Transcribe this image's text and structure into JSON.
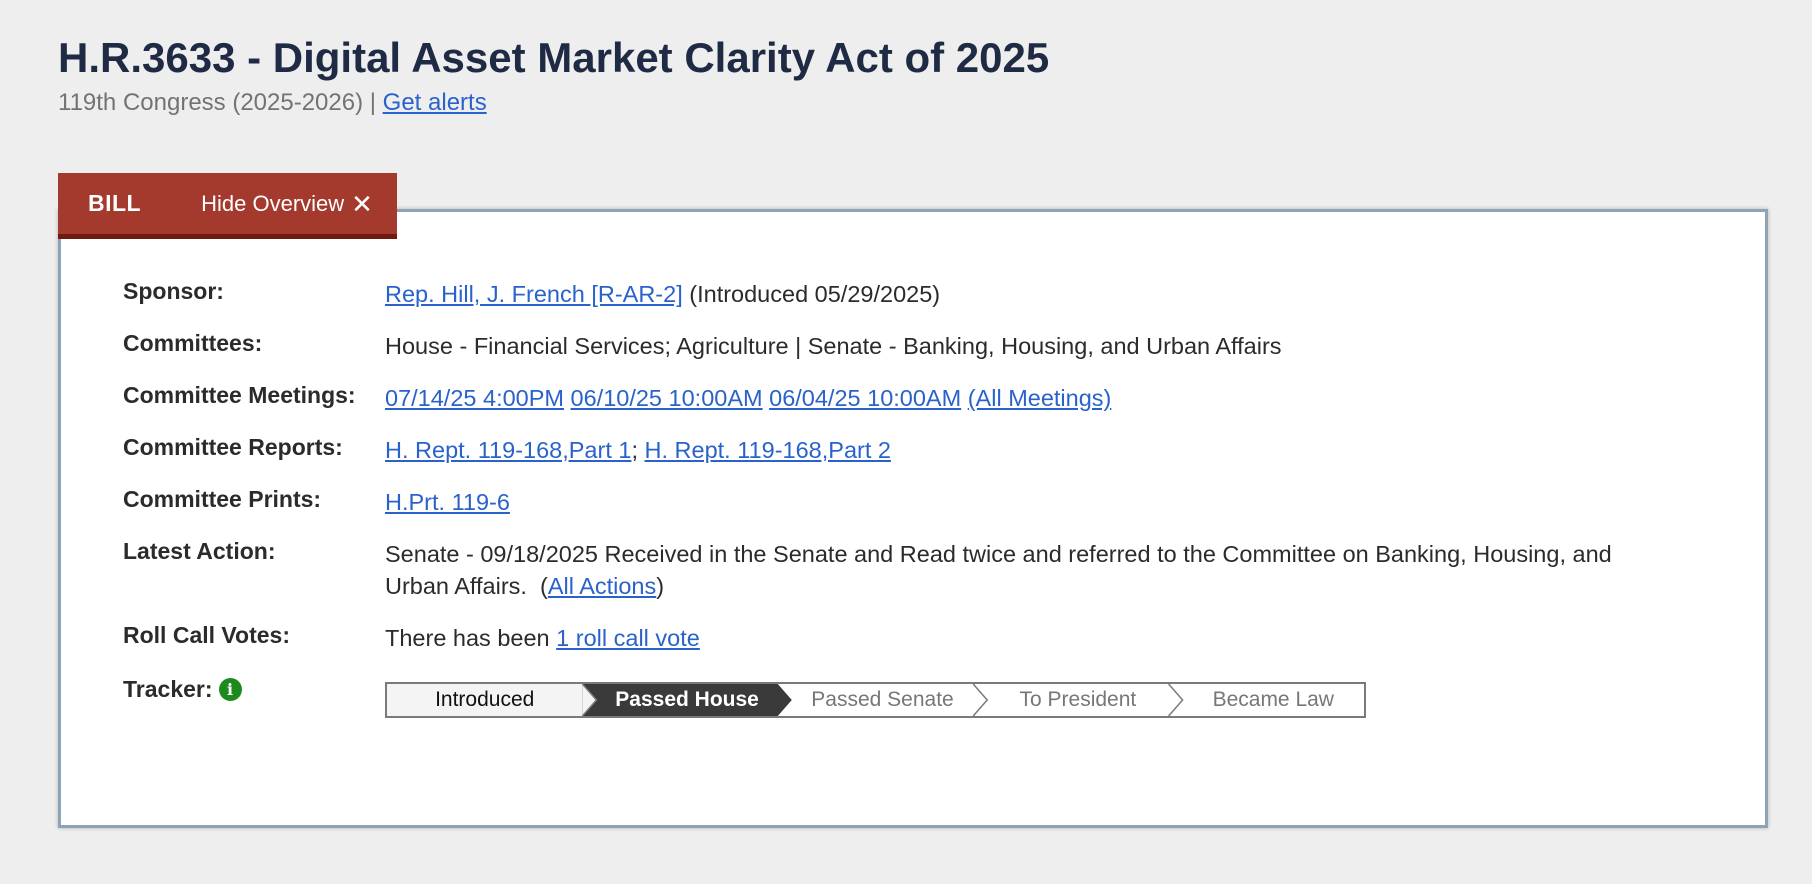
{
  "header": {
    "title": "H.R.3633 - Digital Asset Market Clarity Act of 2025",
    "congress": "119th Congress (2025-2026) | ",
    "alerts_link": "Get alerts"
  },
  "tabs": {
    "bill_label": "BILL",
    "hide_overview_label": "Hide Overview",
    "close_icon": "close-x"
  },
  "overview": {
    "sponsor": {
      "label": "Sponsor:",
      "link": "Rep. Hill, J. French [R-AR-2]",
      "note": " (Introduced 05/29/2025)"
    },
    "committees": {
      "label": "Committees:",
      "text": "House - Financial Services; Agriculture | Senate - Banking, Housing, and Urban Affairs"
    },
    "committee_meetings": {
      "label": "Committee Meetings:",
      "links": [
        "07/14/25 4:00PM",
        "06/10/25 10:00AM",
        "06/04/25 10:00AM",
        "(All Meetings)"
      ]
    },
    "committee_reports": {
      "label": "Committee Reports:",
      "links": [
        "H. Rept. 119-168,Part 1",
        "H. Rept. 119-168,Part 2"
      ],
      "separator": "; "
    },
    "committee_prints": {
      "label": "Committee Prints:",
      "link": "H.Prt. 119-6"
    },
    "latest_action": {
      "label": "Latest Action:",
      "text": "Senate - 09/18/2025 Received in the Senate and Read twice and referred to the Committee on Banking, Housing, and Urban Affairs.",
      "open_paren": "  (",
      "link": "All Actions",
      "close_paren": ")"
    },
    "roll_call_votes": {
      "label": "Roll Call Votes:",
      "text": "There has been ",
      "link": "1 roll call vote"
    },
    "tracker": {
      "label": "Tracker:",
      "info_icon": "info-circle-icon",
      "stages": [
        {
          "name": "Introduced",
          "state": "completed"
        },
        {
          "name": "Passed House",
          "state": "current"
        },
        {
          "name": "Passed Senate",
          "state": "pending"
        },
        {
          "name": "To President",
          "state": "pending"
        },
        {
          "name": "Became Law",
          "state": "pending"
        }
      ]
    }
  },
  "colors": {
    "tab_background": "#a43a2d",
    "tab_border": "#6f1b12",
    "link": "#2a62cc",
    "title": "#1f2a44",
    "tracker_current": "#3a3a3a",
    "tracker_completed": "#f4f4f4",
    "info_icon": "#1e8a1e"
  }
}
